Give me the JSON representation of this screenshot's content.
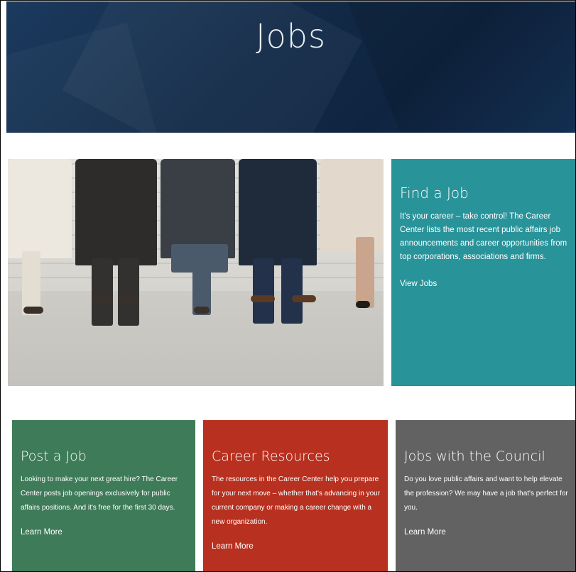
{
  "hero": {
    "title": "Jobs"
  },
  "find_job": {
    "title": "Find a Job",
    "text": "It's your career – take control! The Career Center lists the most recent public affairs job announcements and career opportunities from top corporations, associations and firms.",
    "link": "View Jobs",
    "color": "#29939a"
  },
  "cards": {
    "post": {
      "title": "Post a Job",
      "text": "Looking to make your next great hire? The Career Center posts job openings exclusively for public affairs positions. And it's free for the first 30 days.",
      "link": "Learn More",
      "color": "#3e7b58"
    },
    "resources": {
      "title": "Career Resources",
      "text": "The resources in the Career Center help you prepare for your next move – whether that's advancing in your current company or making a career change with a new organization.",
      "link": "Learn More",
      "color": "#b8301f"
    },
    "council": {
      "title": "Jobs with the Council",
      "text": "Do you love public affairs and want to help elevate the profession? We may have a job that's perfect for you.",
      "link": "Learn More",
      "color": "#626262"
    }
  },
  "header_color": "#16345a"
}
